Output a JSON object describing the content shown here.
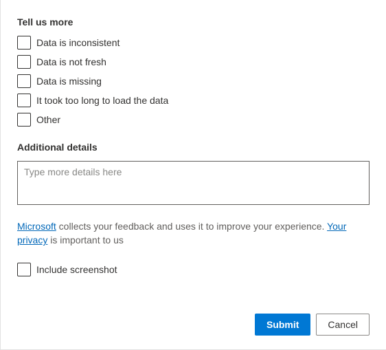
{
  "headings": {
    "tell_us_more": "Tell us more",
    "additional_details": "Additional details"
  },
  "checkboxes": {
    "inconsistent": "Data is inconsistent",
    "not_fresh": "Data is not fresh",
    "missing": "Data is missing",
    "too_long": "It took too long to load the data",
    "other": "Other"
  },
  "textarea": {
    "placeholder": "Type more details here",
    "value": ""
  },
  "disclaimer": {
    "link1": "Microsoft",
    "text1": " collects your feedback and uses it to improve your experience. ",
    "link2": "Your privacy",
    "text2": " is important to us"
  },
  "include_screenshot": "Include screenshot",
  "buttons": {
    "submit": "Submit",
    "cancel": "Cancel"
  }
}
